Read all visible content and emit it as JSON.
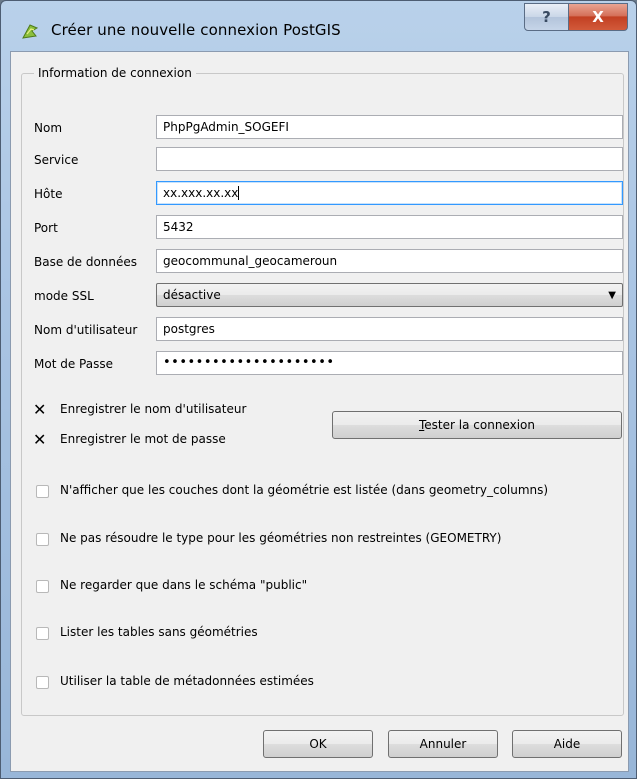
{
  "window": {
    "title": "Créer une nouvelle connexion PostGIS",
    "help_glyph": "?",
    "close_glyph": "X"
  },
  "group": {
    "title": "Information de connexion"
  },
  "fields": {
    "nom": {
      "label": "Nom",
      "value": "PhpPgAdmin_SOGEFI"
    },
    "service": {
      "label": "Service",
      "value": ""
    },
    "hote": {
      "label": "Hôte",
      "value": "xx.xxx.xx.xx"
    },
    "port": {
      "label": "Port",
      "value": "5432"
    },
    "database": {
      "label": "Base de données",
      "value": "geocommunal_geocameroun"
    },
    "ssl": {
      "label": "mode SSL",
      "value": "désactive"
    },
    "user": {
      "label": "Nom d'utilisateur",
      "value": "postgres"
    },
    "password": {
      "label": "Mot de Passe",
      "value": "•••••••••••••••••••••"
    }
  },
  "save_options": {
    "save_user": {
      "label": "Enregistrer le nom d'utilisateur",
      "checked": true
    },
    "save_password": {
      "label": "Enregistrer le mot de passe",
      "checked": true
    }
  },
  "test_button": {
    "mnemonic": "T",
    "rest": "ester la connexion"
  },
  "options": [
    {
      "label": "N'afficher que les couches dont la géométrie est listée (dans geometry_columns)",
      "checked": false
    },
    {
      "label": "Ne pas résoudre le type pour les géométries non restreintes (GEOMETRY)",
      "checked": false
    },
    {
      "label": "Ne regarder que dans le schéma \"public\"",
      "checked": false
    },
    {
      "label": "Lister les tables sans géométries",
      "checked": false
    },
    {
      "label": "Utiliser la table de métadonnées estimées",
      "checked": false
    }
  ],
  "buttons": {
    "ok": "OK",
    "cancel": "Annuler",
    "help": "Aide"
  },
  "x_glyph": "✕"
}
